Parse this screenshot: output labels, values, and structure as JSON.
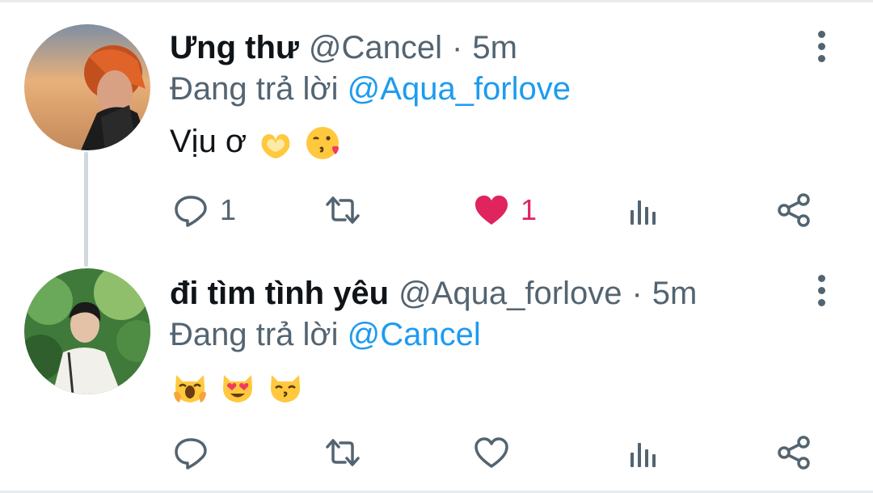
{
  "tweets": [
    {
      "name": "Ưng thư",
      "handle": "@Cancel",
      "time": "5m",
      "reply_prefix": "Đang trả lời",
      "reply_to": "@Aqua_forlove",
      "text": "Vịu ơ",
      "emojis": [
        "heart-hands-emoji",
        "face-blowing-kiss-emoji"
      ],
      "reply_count": "1",
      "like_count": "1",
      "liked": true
    },
    {
      "name": "đi tìm tình yêu",
      "handle": "@Aqua_forlove",
      "time": "5m",
      "reply_prefix": "Đang trả lời",
      "reply_to": "@Cancel",
      "text": "",
      "emojis": [
        "weary-cat-emoji",
        "heart-eyes-cat-emoji",
        "kissing-cat-emoji"
      ],
      "reply_count": "",
      "like_count": "",
      "liked": false
    }
  ],
  "colors": {
    "accent": "#1d9bf0",
    "like": "#e0245e",
    "muted": "#536471",
    "text": "#0f1419"
  }
}
